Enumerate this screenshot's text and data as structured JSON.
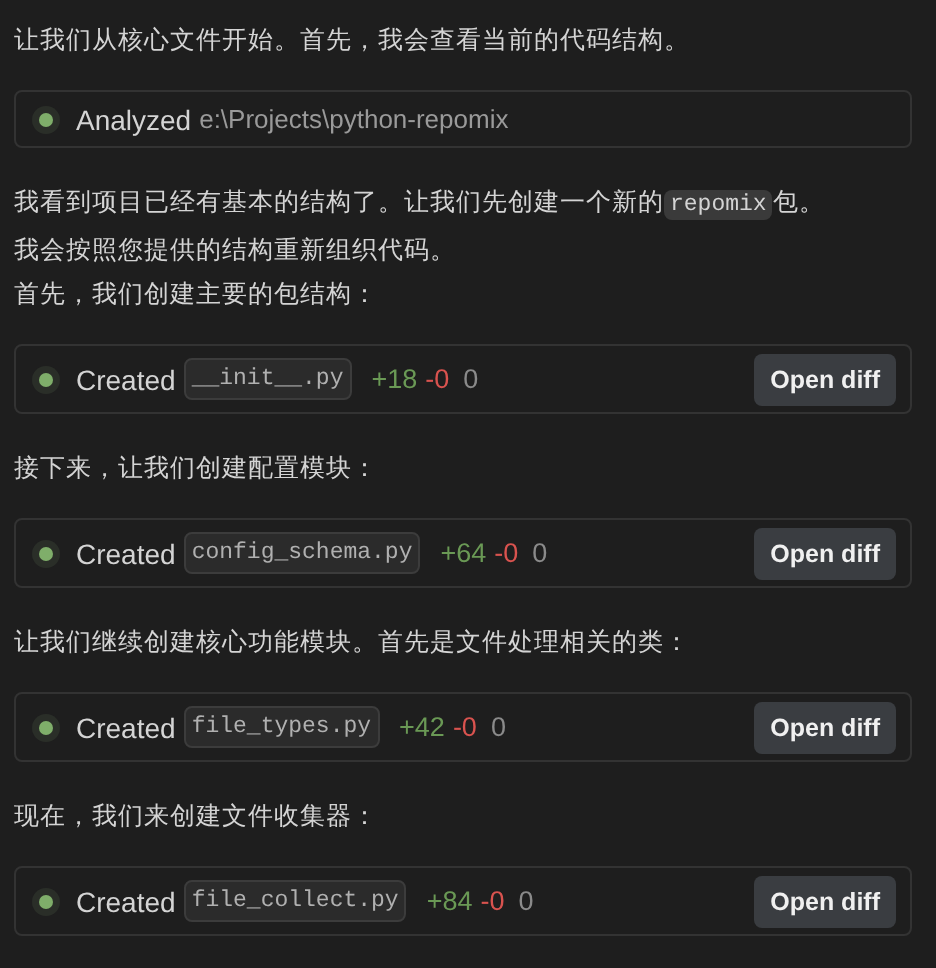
{
  "messages": [
    {
      "kind": "paragraph",
      "lines": [
        [
          {
            "kind": "text",
            "text": "让我们从核心文件开始。首先，我会查看当前的代码结构。"
          }
        ]
      ]
    },
    {
      "kind": "analyzed",
      "label": "Analyzed",
      "path": "e:\\Projects\\python-repomix"
    },
    {
      "kind": "paragraph",
      "lines": [
        [
          {
            "kind": "text",
            "text": "我看到项目已经有基本的结构了。让我们先创建一个新的"
          },
          {
            "kind": "code",
            "text": "repomix"
          },
          {
            "kind": "text",
            "text": "包。"
          }
        ],
        [
          {
            "kind": "text",
            "text": "我会按照您提供的结构重新组织代码。"
          }
        ]
      ]
    },
    {
      "kind": "paragraph",
      "lines": [
        [
          {
            "kind": "text",
            "text": "首先，我们创建主要的包结构："
          }
        ]
      ]
    },
    {
      "kind": "created",
      "label": "Created",
      "file": "__init__.py",
      "added": "+18",
      "removed": "-0",
      "other": "0",
      "button": "Open diff"
    },
    {
      "kind": "paragraph",
      "lines": [
        [
          {
            "kind": "text",
            "text": "接下来，让我们创建配置模块："
          }
        ]
      ]
    },
    {
      "kind": "created",
      "label": "Created",
      "file": "config_schema.py",
      "added": "+64",
      "removed": "-0",
      "other": "0",
      "button": "Open diff"
    },
    {
      "kind": "paragraph",
      "lines": [
        [
          {
            "kind": "text",
            "text": "让我们继续创建核心功能模块。首先是文件处理相关的类："
          }
        ]
      ]
    },
    {
      "kind": "created",
      "label": "Created",
      "file": "file_types.py",
      "added": "+42",
      "removed": "-0",
      "other": "0",
      "button": "Open diff"
    },
    {
      "kind": "paragraph",
      "lines": [
        [
          {
            "kind": "text",
            "text": "现在，我们来创建文件收集器："
          }
        ]
      ]
    },
    {
      "kind": "created",
      "label": "Created",
      "file": "file_collect.py",
      "added": "+84",
      "removed": "-0",
      "other": "0",
      "button": "Open diff"
    }
  ]
}
